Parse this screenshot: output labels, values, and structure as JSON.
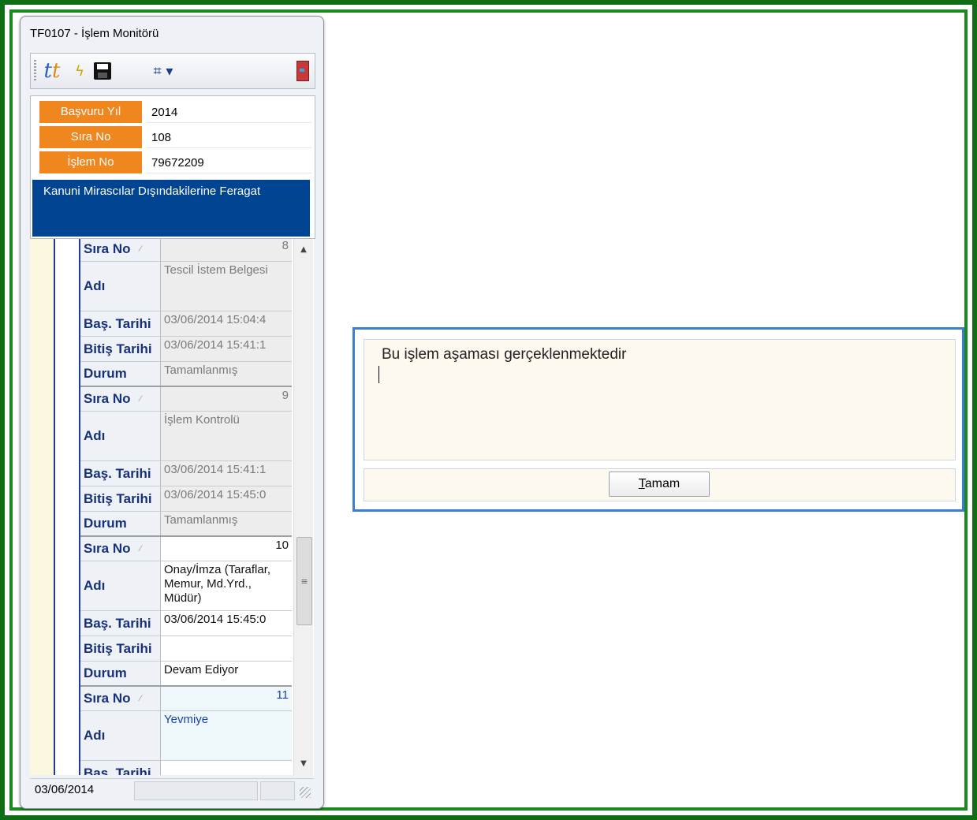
{
  "window": {
    "title": "TF0107 - İşlem Monitörü"
  },
  "toolbar": {
    "logo_icon": "t-logo-icon",
    "bolt_icon": "lightning-icon",
    "save_icon": "save-disk-icon",
    "layout_icon": "layout-dropdown-icon",
    "exit_icon": "exit-door-icon"
  },
  "header": {
    "rows": [
      {
        "label": "Başvuru Yıl",
        "value": "2014"
      },
      {
        "label": "Sıra No",
        "value": "108"
      },
      {
        "label": "İşlem No",
        "value": "79672209"
      }
    ],
    "description": "Kanuni Mirascılar Dışındakilerine Feragat",
    "label_color": "#f0861e",
    "description_bg": "#004492"
  },
  "grid": {
    "field_labels": {
      "sira_no": "Sıra No",
      "adi": "Adı",
      "bas_tarihi": "Baş. Tarihi",
      "bitis_tarihi": "Bitiş Tarihi",
      "durum": "Durum"
    },
    "records": [
      {
        "sira_no": "8",
        "adi": "Tescil İstem Belgesi",
        "bas_tarihi": "03/06/2014 15:04:4",
        "bitis_tarihi": "03/06/2014 15:41:1",
        "durum": "Tamamlanmış"
      },
      {
        "sira_no": "9",
        "adi": "İşlem Kontrolü",
        "bas_tarihi": "03/06/2014 15:41:1",
        "bitis_tarihi": "03/06/2014 15:45:0",
        "durum": "Tamamlanmış"
      },
      {
        "sira_no": "10",
        "adi": "Onay/İmza (Taraflar, Memur, Md.Yrd., Müdür)",
        "bas_tarihi": "03/06/2014 15:45:0",
        "bitis_tarihi": "",
        "durum": "Devam Ediyor"
      },
      {
        "sira_no": "11",
        "adi": "Yevmiye",
        "bas_tarihi": "",
        "bitis_tarihi": "",
        "durum": ""
      }
    ]
  },
  "statusbar": {
    "date": "03/06/2014"
  },
  "dialog": {
    "message": "Bu işlem aşaması gerçeklenmektedir",
    "ok_underlined": "T",
    "ok_rest": "amam"
  }
}
